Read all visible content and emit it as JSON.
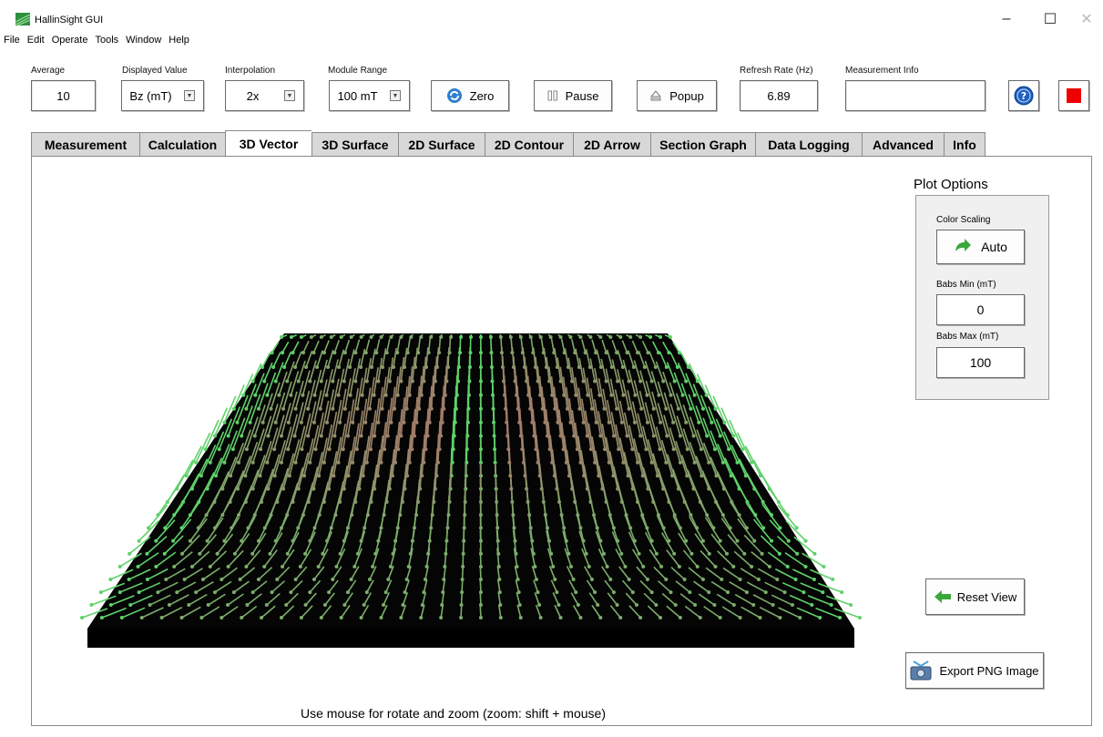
{
  "window": {
    "title": "HallinSight GUI",
    "controls": {
      "minimize": "–",
      "maximize": "☐",
      "close": "✕"
    }
  },
  "menu": [
    "File",
    "Edit",
    "Operate",
    "Tools",
    "Window",
    "Help"
  ],
  "toolbar": {
    "average": {
      "label": "Average",
      "value": "10"
    },
    "displayed_value": {
      "label": "Displayed Value",
      "value": "Bz (mT)"
    },
    "interpolation": {
      "label": "Interpolation",
      "value": "2x"
    },
    "module_range": {
      "label": "Module Range",
      "value": "100 mT"
    },
    "zero_label": "Zero",
    "pause_label": "Pause",
    "popup_label": "Popup",
    "refresh_rate": {
      "label": "Refresh Rate (Hz)",
      "value": "6.89"
    },
    "measurement_info": {
      "label": "Measurement Info",
      "value": ""
    }
  },
  "tabs": [
    {
      "label": "Measurement",
      "active": false
    },
    {
      "label": "Calculation",
      "active": false
    },
    {
      "label": "3D Vector",
      "active": true
    },
    {
      "label": "3D Surface",
      "active": false
    },
    {
      "label": "2D Surface",
      "active": false
    },
    {
      "label": "2D Contour",
      "active": false
    },
    {
      "label": "2D Arrow",
      "active": false
    },
    {
      "label": "Section Graph",
      "active": false
    },
    {
      "label": "Data Logging",
      "active": false
    },
    {
      "label": "Advanced",
      "active": false
    },
    {
      "label": "Info",
      "active": false
    }
  ],
  "plot_options": {
    "title": "Plot Options",
    "color_scaling": {
      "label": "Color Scaling",
      "button": "Auto"
    },
    "babs_min": {
      "label": "Babs Min (mT)",
      "value": "0"
    },
    "babs_max": {
      "label": "Babs Max (mT)",
      "value": "100"
    }
  },
  "reset_view_label": "Reset View",
  "export_label": "Export PNG Image",
  "hint_text": "Use mouse for rotate and zoom (zoom: shift + mouse)",
  "colors": {
    "accent_green": "#3aa83a",
    "stop_red": "#ee0000",
    "help_blue": "#1f5fbf",
    "vector_green": "#5fd16a",
    "vector_red": "#b06a6a"
  },
  "icons": [
    "app-icon",
    "refresh-icon",
    "pause-icon",
    "eject-icon",
    "help-icon",
    "stop-icon",
    "arrow-right-green-icon",
    "arrow-left-green-icon",
    "export-image-icon"
  ]
}
